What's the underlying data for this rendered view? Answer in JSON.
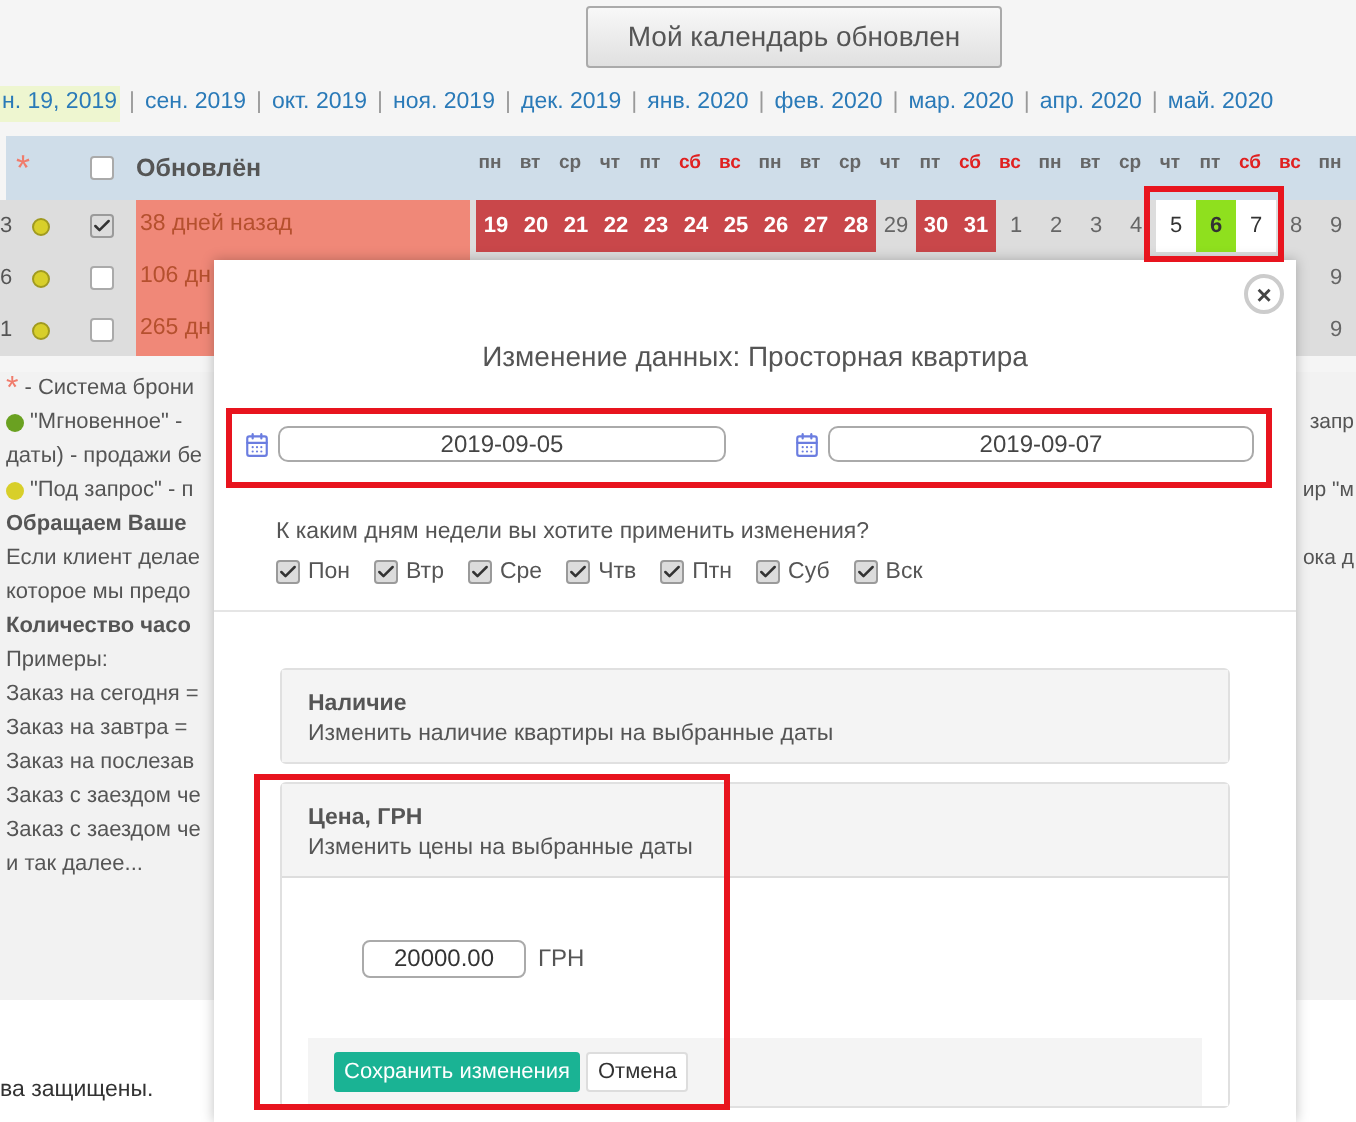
{
  "update_button": "Мой календарь обновлен",
  "months": [
    {
      "label": "н. 19, 2019",
      "selected": true
    },
    {
      "label": "сен. 2019",
      "selected": false
    },
    {
      "label": "окт. 2019",
      "selected": false
    },
    {
      "label": "ноя. 2019",
      "selected": false
    },
    {
      "label": "дек. 2019",
      "selected": false
    },
    {
      "label": "янв. 2020",
      "selected": false
    },
    {
      "label": "фев. 2020",
      "selected": false
    },
    {
      "label": "мар. 2020",
      "selected": false
    },
    {
      "label": "апр. 2020",
      "selected": false
    },
    {
      "label": "май. 2020",
      "selected": false
    }
  ],
  "month_separator": "|",
  "table": {
    "star": "*",
    "updated_header": "Обновлён",
    "header_checked": false,
    "weekdays": [
      {
        "label": "пн",
        "weekend": false
      },
      {
        "label": "вт",
        "weekend": false
      },
      {
        "label": "ср",
        "weekend": false
      },
      {
        "label": "чт",
        "weekend": false
      },
      {
        "label": "пт",
        "weekend": false
      },
      {
        "label": "сб",
        "weekend": true
      },
      {
        "label": "вс",
        "weekend": true
      },
      {
        "label": "пн",
        "weekend": false
      },
      {
        "label": "вт",
        "weekend": false
      },
      {
        "label": "ср",
        "weekend": false
      },
      {
        "label": "чт",
        "weekend": false
      },
      {
        "label": "пт",
        "weekend": false
      },
      {
        "label": "сб",
        "weekend": true
      },
      {
        "label": "вс",
        "weekend": true
      },
      {
        "label": "пн",
        "weekend": false
      },
      {
        "label": "вт",
        "weekend": false
      },
      {
        "label": "ср",
        "weekend": false
      },
      {
        "label": "чт",
        "weekend": false
      },
      {
        "label": "пт",
        "weekend": false
      },
      {
        "label": "сб",
        "weekend": true
      },
      {
        "label": "вс",
        "weekend": true
      },
      {
        "label": "пн",
        "weekend": false
      }
    ],
    "rows": [
      {
        "label": "3",
        "checked": true,
        "updated": "38 дней назад",
        "days": [
          {
            "text": "19",
            "kind": "booked"
          },
          {
            "text": "20",
            "kind": "booked"
          },
          {
            "text": "21",
            "kind": "booked"
          },
          {
            "text": "22",
            "kind": "booked"
          },
          {
            "text": "23",
            "kind": "booked"
          },
          {
            "text": "24",
            "kind": "booked"
          },
          {
            "text": "25",
            "kind": "booked"
          },
          {
            "text": "26",
            "kind": "booked"
          },
          {
            "text": "27",
            "kind": "booked"
          },
          {
            "text": "28",
            "kind": "booked"
          },
          {
            "text": "29",
            "kind": "free"
          },
          {
            "text": "30",
            "kind": "booked"
          },
          {
            "text": "31",
            "kind": "booked"
          },
          {
            "text": "1",
            "kind": "free"
          },
          {
            "text": "2",
            "kind": "free"
          },
          {
            "text": "3",
            "kind": "free"
          },
          {
            "text": "4",
            "kind": "free"
          },
          {
            "text": "5",
            "kind": "selected"
          },
          {
            "text": "6",
            "kind": "changed"
          },
          {
            "text": "7",
            "kind": "selected"
          },
          {
            "text": "8",
            "kind": "free"
          },
          {
            "text": "9",
            "kind": "free"
          }
        ]
      },
      {
        "label": "6",
        "checked": false,
        "updated": "106 дн",
        "days": [
          {
            "text": "9",
            "kind": "free"
          }
        ]
      },
      {
        "label": "1",
        "checked": false,
        "updated": "265 дн",
        "days": [
          {
            "text": "9",
            "kind": "free"
          }
        ]
      }
    ]
  },
  "notes": [
    {
      "kind": "star",
      "mark": "*",
      "text": "- Система брони"
    },
    {
      "kind": "dot",
      "color": "#6aa121",
      "text": "\"Мгновенное\" -",
      "right": "запр"
    },
    {
      "kind": "plain",
      "text": "даты) - продажи бе"
    },
    {
      "kind": "dot",
      "color": "#d8cf2a",
      "text": "\"Под запрос\" - п",
      "right": "ир \"м"
    },
    {
      "kind": "bold",
      "text": "Обращаем Ваше"
    },
    {
      "kind": "plain",
      "text": "Если клиент делае",
      "right": "ока д"
    },
    {
      "kind": "plain",
      "text": "которое мы предо"
    },
    {
      "kind": "bold",
      "text": "Количество часо"
    },
    {
      "kind": "plain",
      "text": "Примеры:"
    },
    {
      "kind": "plain",
      "text": "Заказ на сегодня ="
    },
    {
      "kind": "plain",
      "text": "Заказ на завтра = "
    },
    {
      "kind": "plain",
      "text": "Заказ на послезав"
    },
    {
      "kind": "plain",
      "text": "Заказ с заездом че"
    },
    {
      "kind": "plain",
      "text": "Заказ с заездом че"
    },
    {
      "kind": "plain",
      "text": "и так далее..."
    }
  ],
  "footer": "ва защищены.",
  "dialog": {
    "title": "Изменение данных: Просторная квартира",
    "close": "×",
    "date_from": "2019-09-05",
    "date_to": "2019-09-07",
    "question": "К каким дням недели вы хотите применить изменения?",
    "days": [
      {
        "label": "Пон",
        "checked": true
      },
      {
        "label": "Втр",
        "checked": true
      },
      {
        "label": "Сре",
        "checked": true
      },
      {
        "label": "Чтв",
        "checked": true
      },
      {
        "label": "Птн",
        "checked": true
      },
      {
        "label": "Суб",
        "checked": true
      },
      {
        "label": "Вск",
        "checked": true
      }
    ],
    "panels": [
      {
        "title": "Наличие",
        "subtitle": "Изменить наличие квартиры на выбранные даты",
        "expanded": false
      },
      {
        "title": "Цена, ГРН",
        "subtitle": "Изменить цены на выбранные даты",
        "expanded": true,
        "price": "20000.00",
        "currency": "ГРН",
        "save": "Сохранить изменения",
        "cancel": "Отмена"
      }
    ]
  }
}
